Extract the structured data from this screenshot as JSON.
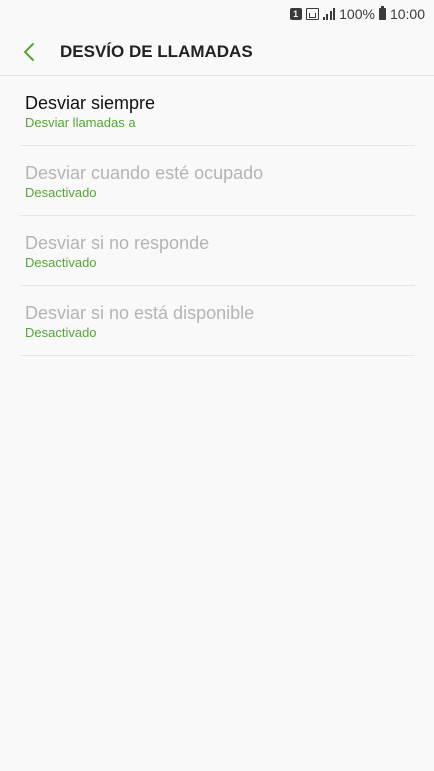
{
  "status_bar": {
    "sim": "1",
    "battery": "100%",
    "time": "10:00"
  },
  "header": {
    "title": "DESVÍO DE LLAMADAS"
  },
  "items": [
    {
      "title": "Desviar siempre",
      "subtitle": "Desviar llamadas a",
      "enabled": true
    },
    {
      "title": "Desviar cuando esté ocupado",
      "subtitle": "Desactivado",
      "enabled": false
    },
    {
      "title": "Desviar si no responde",
      "subtitle": "Desactivado",
      "enabled": false
    },
    {
      "title": "Desviar si no está disponible",
      "subtitle": "Desactivado",
      "enabled": false
    }
  ],
  "colors": {
    "accent": "#55a535",
    "background": "#f9f9f9",
    "disabled_text": "#b4b4b4"
  }
}
